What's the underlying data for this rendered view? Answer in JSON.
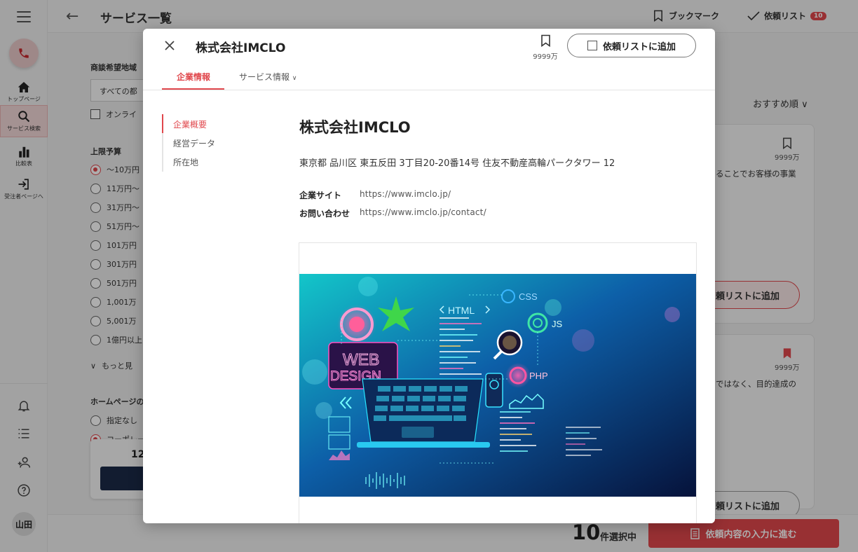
{
  "app": {
    "page_title": "サービス一覧",
    "header": {
      "bookmark_label": "ブックマーク",
      "request_list_label": "依頼リスト",
      "request_count": "10"
    },
    "sidebar": {
      "items": [
        {
          "label": "トップページ",
          "icon": "home-icon"
        },
        {
          "label": "サービス検索",
          "icon": "search-icon"
        },
        {
          "label": "比較表",
          "icon": "bar-chart-icon"
        },
        {
          "label": "受注者ページへ",
          "icon": "login-icon"
        }
      ],
      "user_initials": "山田"
    },
    "filters": {
      "region_label": "商談希望地域",
      "region_value": "すべての都",
      "online_label": "オンライ",
      "budget_label": "上限予算",
      "budget_options": [
        "～10万円",
        "11万円～",
        "31万円～",
        "51万円～",
        "101万円",
        "301万円",
        "501万円",
        "1,001万",
        "5,001万",
        "1億円以上"
      ],
      "more_label": "もっと見",
      "homepage_label": "ホームページの",
      "homepage_options": [
        "指定なし",
        "コーポレー"
      ],
      "floating_count": "12"
    },
    "results": {
      "sort_label": "おすすめ順",
      "card1_count": "9999万",
      "card1_desc": "ることでお客様の事業",
      "card1_button": "頼リストに追加",
      "card2_count": "9999万",
      "card2_desc": "ではなく、目的達成の",
      "card2_button": "頼リストに追加"
    },
    "footer": {
      "selected_count": "10",
      "selected_label": "件選択中",
      "proceed_label": "依頼内容の入力に進む"
    }
  },
  "modal": {
    "title": "株式会社IMCLO",
    "bookmark_count": "9999万",
    "add_button_label": "依頼リストに追加",
    "tabs": [
      {
        "label": "企業情報",
        "active": true
      },
      {
        "label": "サービス情報",
        "active": false
      }
    ],
    "subnav": [
      "企業概要",
      "経営データ",
      "所在地"
    ],
    "company": {
      "name": "株式会社IMCLO",
      "address": "東京都 品川区 東五反田 3丁目20-20番14号 住友不動産高輪パークタワー 12",
      "website_label": "企業サイト",
      "website_url": "https://www.imclo.jp/",
      "contact_label": "お問い合わせ",
      "contact_url": "https://www.imclo.jp/contact/"
    },
    "hero_image": {
      "text_web": "WEB",
      "text_design": "DESIGN",
      "text_html": "HTML",
      "text_css": "CSS",
      "text_js": "JS",
      "text_php": "PHP"
    }
  }
}
